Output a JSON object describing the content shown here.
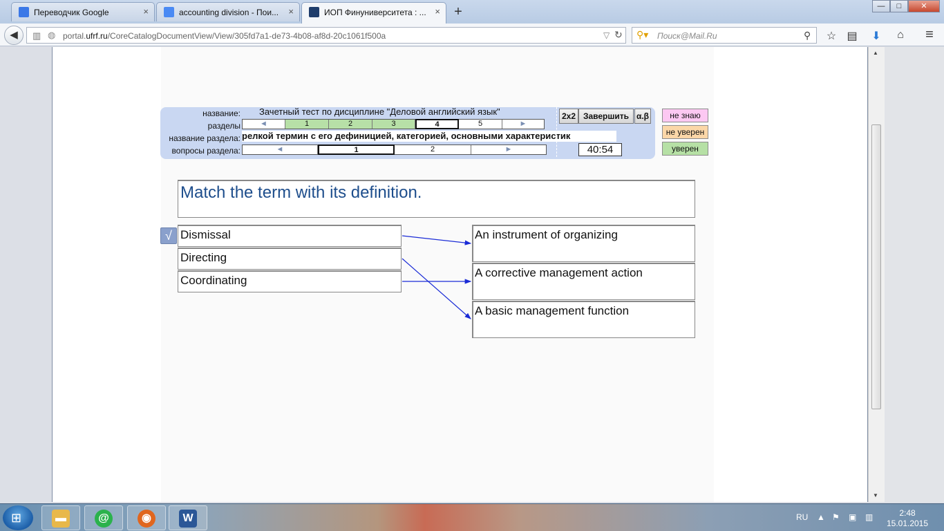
{
  "browser": {
    "tabs": [
      {
        "label": "Переводчик Google",
        "close": "×"
      },
      {
        "label": "accounting division - Пои...",
        "close": "×"
      },
      {
        "label": "ИОП Финуниверситета : ...",
        "close": "×"
      }
    ],
    "new_tab": "+",
    "window_controls": {
      "minimize": "—",
      "maximize": "□",
      "close": "✕"
    },
    "url_prefix": "portal.",
    "url_host": "ufrf.ru",
    "url_path": "/CoreCatalogDocumentView/View/305fd7a1-de73-4b08-af8d-20c1061f500a",
    "search_placeholder": "Поиск@Mail.Ru",
    "icons": {
      "back": "◀",
      "bookmark": "☆",
      "reading_list": "▤",
      "download": "⬇",
      "home": "⌂",
      "menu": "≡",
      "reload": "↻",
      "search": "⚲"
    }
  },
  "test": {
    "labels": {
      "name": "название:",
      "sections": "разделы",
      "section_name": "название раздела:",
      "section_questions": "вопросы раздела:"
    },
    "title": "Зачетный тест по дисциплине \"Деловой английский язык\"",
    "sections": [
      "1",
      "2",
      "3",
      "4",
      "5"
    ],
    "section_states": [
      "done",
      "done",
      "done",
      "current",
      "none"
    ],
    "section_name": "релкой термин с его дефиницией, категорией, основными характеристик",
    "questions": [
      "1",
      "2"
    ],
    "arrow_left": "◄",
    "arrow_right": "►",
    "buttons": {
      "grid": "2x2",
      "finish": "Завершить",
      "alpha_beta": "α.β"
    },
    "timer": "40:54",
    "status": {
      "dont_know": "не знаю",
      "not_sure": "не уверен",
      "sure": "уверен"
    },
    "colors": {
      "dont_know": "#fcc8f2",
      "not_sure": "#fbd7a8",
      "sure": "#b6e0a5",
      "done": "#b7e0a7",
      "panel": "#c9d7f2"
    }
  },
  "question": {
    "text": "Match the term with its definition.",
    "answered_mark": "√",
    "terms": [
      "Dismissal",
      "Directing",
      "Coordinating"
    ],
    "definitions": [
      "An instrument of organizing",
      "A corrective management action",
      "A basic management function"
    ],
    "matches": [
      {
        "term": "Dismissal",
        "definition": "An instrument of organizing"
      },
      {
        "term": "Directing",
        "definition": "A basic management function"
      },
      {
        "term": "Coordinating",
        "definition": "A corrective management action"
      }
    ]
  },
  "taskbar": {
    "start": "⊞",
    "apps": [
      {
        "name": "explorer",
        "glyph": "▬",
        "color": "#e8b84a"
      },
      {
        "name": "mail-agent",
        "glyph": "@",
        "color": "#2bb24c"
      },
      {
        "name": "firefox",
        "glyph": "◉",
        "color": "#e0661e"
      },
      {
        "name": "word",
        "glyph": "W",
        "color": "#2b5797"
      }
    ],
    "lang": "RU",
    "time": "2:48",
    "date": "15.01.2015"
  }
}
